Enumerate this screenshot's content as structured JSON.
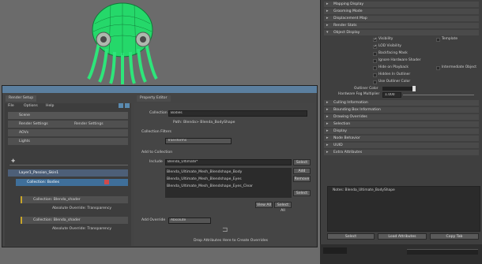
{
  "attribute_editor": {
    "sections": [
      "Mapping Display",
      "Grooming Mode",
      "Displacement Map",
      "Render Stats",
      "Object Display"
    ],
    "object_display_checks": [
      {
        "label": "Visibility",
        "checked": true
      },
      {
        "label": "Template",
        "checked": false
      },
      {
        "label": "LOD Visibility",
        "checked": true
      },
      {
        "label": "Backfacing Mask",
        "checked": false
      },
      {
        "label": "Ignore Hardware Shader",
        "checked": false
      },
      {
        "label": "Hide on Playback",
        "checked": false
      },
      {
        "label": "Intermediate Object",
        "checked": false
      },
      {
        "label": "Hidden In Outliner",
        "checked": false
      },
      {
        "label": "Use Outliner Color",
        "checked": false
      }
    ],
    "outliner_color_label": "Outliner Color",
    "hardware_fog_label": "Hardware Fog Multiplier",
    "hardware_fog_value": "1.000",
    "sections_lower": [
      "Culling Information",
      "Bounding Box Information",
      "Drawing Overrides",
      "Selection",
      "Display",
      "Node Behavior",
      "UUID",
      "Extra Attributes"
    ],
    "notes": "Notes: Blenda_Ultimate_BodyShape",
    "buttons": [
      "Select",
      "Load Attributes",
      "Copy Tab"
    ]
  },
  "render_setup": {
    "tabs": [
      "Render Setup",
      "Property Editor"
    ],
    "menu": [
      "File",
      "Options",
      "Help"
    ],
    "scene_label": "Scene",
    "scene_items": [
      "Render Settings",
      "AOVs",
      "Lights"
    ],
    "scene_item_right": "Render Settings",
    "layer": "Layer1_Passion_Skin1",
    "collection_top": "Collection: Bodies",
    "collections": [
      {
        "name": "Collection: Blenda_shader",
        "override": "Absolute Override: Transparency"
      },
      {
        "name": "Collection: Blenda_shader",
        "override": "Absolute Override: Transparency"
      }
    ]
  },
  "property_editor": {
    "name_label": "Collection",
    "name_value": "Bodies",
    "path": "Path: Blenda> Blenda_BodyShape",
    "filters_label": "Collection Filters",
    "filter_value": "Transforms",
    "add_label": "Add to Collection",
    "include_label": "Include",
    "include_placeholder": "Blenda_Ultimate*",
    "select_btn": "Select",
    "add_btn": "Add",
    "remove_btn": "Remove",
    "list": [
      "Blenda_Ultimate_Mesh_Blendshape_Body",
      "Blenda_Ultimate_Mesh_Blendshape_Eyes",
      "Blenda_Ultimate_Mesh_Blendshape_Eyes_Clear"
    ],
    "select_btn2": "Select",
    "view_all": "View All",
    "select_all": "Select All",
    "add_override_label": "Add Override",
    "override_value": "Absolute",
    "drop_text": "Drop Attributes Here to Create Overrides"
  }
}
